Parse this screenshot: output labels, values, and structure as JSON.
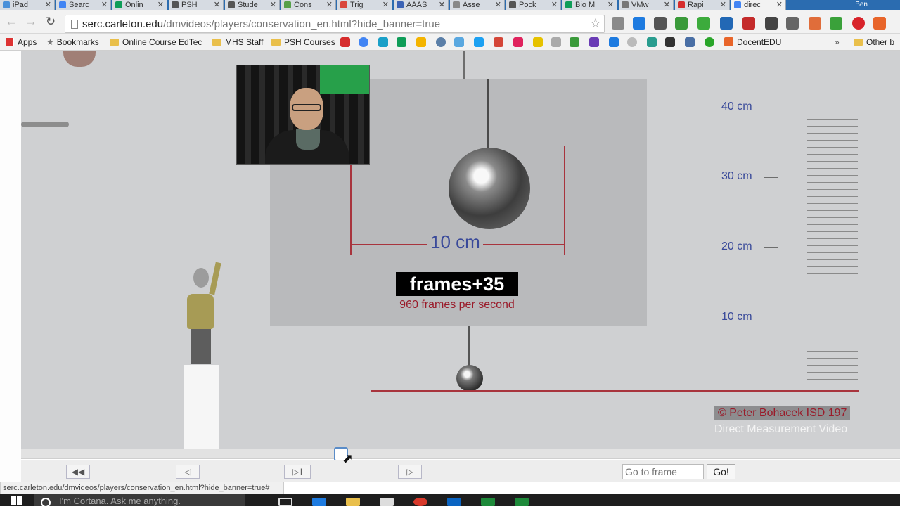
{
  "browser": {
    "tabs": [
      {
        "label": "iPad",
        "color": "#4a90d9"
      },
      {
        "label": "Searc",
        "color": "#4285f4"
      },
      {
        "label": "Onlin",
        "color": "#0f9d58"
      },
      {
        "label": "PSH",
        "color": "#555555"
      },
      {
        "label": "Stude",
        "color": "#555555"
      },
      {
        "label": "Cons",
        "color": "#56a04a"
      },
      {
        "label": "Trig",
        "color": "#d9453b"
      },
      {
        "label": "AAAS",
        "color": "#3b63b5"
      },
      {
        "label": "Asse",
        "color": "#888888"
      },
      {
        "label": "Pock",
        "color": "#555555"
      },
      {
        "label": "Bio M",
        "color": "#0f9d58"
      },
      {
        "label": "VMw",
        "color": "#777777"
      },
      {
        "label": "Rapi",
        "color": "#d62c2c"
      },
      {
        "label": "direc",
        "color": "#4285f4"
      }
    ],
    "profile_name": "Ben",
    "url_host": "serc.carleton.edu",
    "url_path": "/dmvideos/players/conservation_en.html?hide_banner=true"
  },
  "bookmarks": {
    "apps": "Apps",
    "bookmarks": "Bookmarks",
    "folders": [
      "Online Course EdTech",
      "MHS Staff",
      "PSH Courses"
    ],
    "docent": "DocentEDU",
    "other": "Other b"
  },
  "video": {
    "dimension_label": "10 cm",
    "frames_label": "frames+35",
    "fps_label": "960 frames per second",
    "scale_labels": [
      "40 cm",
      "30 cm",
      "20 cm",
      "10 cm"
    ],
    "credit_line1": "© Peter Bohacek ISD 197",
    "credit_line2": "Direct Measurement Video"
  },
  "controls": {
    "go_to_frame_placeholder": "Go to frame",
    "go_label": "Go!",
    "status_url": "serc.carleton.edu/dmvideos/players/conservation_en.html?hide_banner=true#"
  },
  "taskbar": {
    "cortana_placeholder": "I'm Cortana. Ask me anything."
  }
}
